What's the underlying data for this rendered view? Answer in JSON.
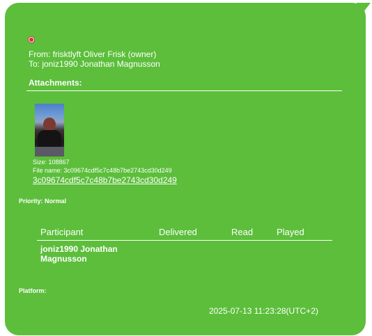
{
  "message": {
    "from": "From: frisktlyft Oliver Frisk (owner)",
    "to": "To: joniz1990 Jonathan Magnusson",
    "attachments_heading": "Attachments:",
    "attachment": {
      "size": "Size: 108867",
      "file_name": "File name: 3c09674cdf5c7c48b7be2743cd30d249",
      "link": "3c09674cdf5c7c48b7be2743cd30d249"
    },
    "priority": "Priority: Normal",
    "table": {
      "headers": [
        "Participant",
        "Delivered",
        "Read",
        "Played"
      ],
      "rows": [
        {
          "participant": "joniz1990 Jonathan Magnusson",
          "delivered": "",
          "read": "",
          "played": ""
        }
      ]
    },
    "platform": "Platform:",
    "timestamp": "2025-07-13 11:23:28(UTC+2)"
  },
  "colors": {
    "bubble": "#5cbe3b",
    "text": "#ffffff",
    "status_icon": "#d23636"
  },
  "icons": {
    "status": "close-icon"
  }
}
